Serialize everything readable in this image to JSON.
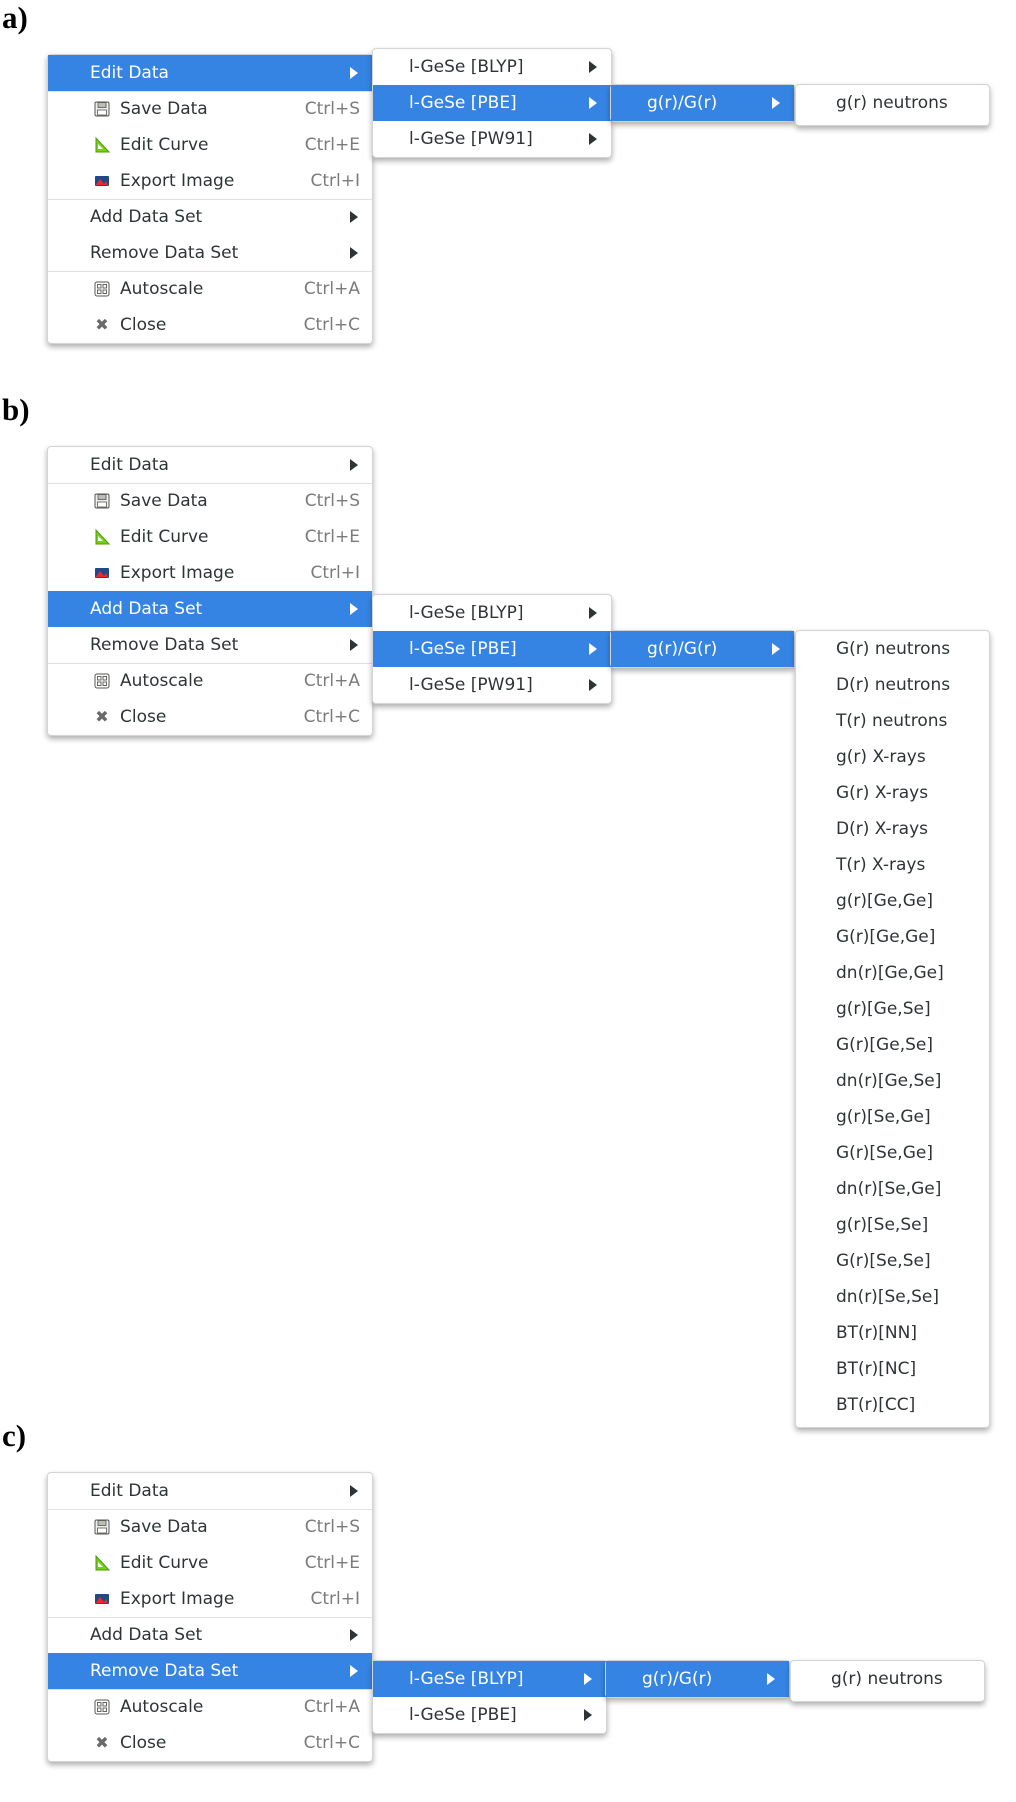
{
  "panels": [
    {
      "label": "a)",
      "main_menu": [
        {
          "label": "Edit Data",
          "shortcut": "",
          "icon": "",
          "submenu": true
        },
        {
          "label": "Save Data",
          "shortcut": "Ctrl+S",
          "icon": "save-icon",
          "submenu": false
        },
        {
          "label": "Edit Curve",
          "shortcut": "Ctrl+E",
          "icon": "edit-curve-icon",
          "submenu": false
        },
        {
          "label": "Export Image",
          "shortcut": "Ctrl+I",
          "icon": "export-image-icon",
          "submenu": false
        },
        {
          "label": "Add Data Set",
          "shortcut": "",
          "icon": "",
          "submenu": true
        },
        {
          "label": "Remove Data Set",
          "shortcut": "",
          "icon": "",
          "submenu": true
        },
        {
          "label": "Autoscale",
          "shortcut": "Ctrl+A",
          "icon": "autoscale-icon",
          "submenu": false
        },
        {
          "label": "Close",
          "shortcut": "Ctrl+C",
          "icon": "close-icon",
          "submenu": false
        }
      ],
      "highlighted": "Edit Data",
      "datasets": [
        "l-GeSe [BLYP]",
        "l-GeSe [PBE]",
        "l-GeSe [PW91]"
      ],
      "dataset_highlighted": "l-GeSe [PBE]",
      "function_menu": [
        "g(r)/G(r)"
      ],
      "leaf_items": [
        "g(r) neutrons"
      ]
    },
    {
      "label": "b)",
      "main_menu": [
        {
          "label": "Edit Data",
          "shortcut": "",
          "icon": "",
          "submenu": true
        },
        {
          "label": "Save Data",
          "shortcut": "Ctrl+S",
          "icon": "save-icon",
          "submenu": false
        },
        {
          "label": "Edit Curve",
          "shortcut": "Ctrl+E",
          "icon": "edit-curve-icon",
          "submenu": false
        },
        {
          "label": "Export Image",
          "shortcut": "Ctrl+I",
          "icon": "export-image-icon",
          "submenu": false
        },
        {
          "label": "Add Data Set",
          "shortcut": "",
          "icon": "",
          "submenu": true
        },
        {
          "label": "Remove Data Set",
          "shortcut": "",
          "icon": "",
          "submenu": true
        },
        {
          "label": "Autoscale",
          "shortcut": "Ctrl+A",
          "icon": "autoscale-icon",
          "submenu": false
        },
        {
          "label": "Close",
          "shortcut": "Ctrl+C",
          "icon": "close-icon",
          "submenu": false
        }
      ],
      "highlighted": "Add Data Set",
      "datasets": [
        "l-GeSe [BLYP]",
        "l-GeSe [PBE]",
        "l-GeSe [PW91]"
      ],
      "dataset_highlighted": "l-GeSe [PBE]",
      "function_menu": [
        "g(r)/G(r)"
      ],
      "leaf_items": [
        "G(r) neutrons",
        "D(r) neutrons",
        "T(r) neutrons",
        "g(r) X-rays",
        "G(r) X-rays",
        "D(r) X-rays",
        "T(r) X-rays",
        "g(r)[Ge,Ge]",
        "G(r)[Ge,Ge]",
        "dn(r)[Ge,Ge]",
        "g(r)[Ge,Se]",
        "G(r)[Ge,Se]",
        "dn(r)[Ge,Se]",
        "g(r)[Se,Ge]",
        "G(r)[Se,Ge]",
        "dn(r)[Se,Ge]",
        "g(r)[Se,Se]",
        "G(r)[Se,Se]",
        "dn(r)[Se,Se]",
        "BT(r)[NN]",
        "BT(r)[NC]",
        "BT(r)[CC]"
      ]
    },
    {
      "label": "c)",
      "main_menu": [
        {
          "label": "Edit Data",
          "shortcut": "",
          "icon": "",
          "submenu": true
        },
        {
          "label": "Save Data",
          "shortcut": "Ctrl+S",
          "icon": "save-icon",
          "submenu": false
        },
        {
          "label": "Edit Curve",
          "shortcut": "Ctrl+E",
          "icon": "edit-curve-icon",
          "submenu": false
        },
        {
          "label": "Export Image",
          "shortcut": "Ctrl+I",
          "icon": "export-image-icon",
          "submenu": false
        },
        {
          "label": "Add Data Set",
          "shortcut": "",
          "icon": "",
          "submenu": true
        },
        {
          "label": "Remove Data Set",
          "shortcut": "",
          "icon": "",
          "submenu": true
        },
        {
          "label": "Autoscale",
          "shortcut": "Ctrl+A",
          "icon": "autoscale-icon",
          "submenu": false
        },
        {
          "label": "Close",
          "shortcut": "Ctrl+C",
          "icon": "close-icon",
          "submenu": false
        }
      ],
      "highlighted": "Remove Data Set",
      "datasets": [
        "l-GeSe [BLYP]",
        "l-GeSe [PBE]"
      ],
      "dataset_highlighted": "l-GeSe [BLYP]",
      "function_menu": [
        "g(r)/G(r)"
      ],
      "leaf_items": [
        "g(r) neutrons"
      ]
    }
  ],
  "colors": {
    "highlight": "#3584e4",
    "text": "#2e3436",
    "shortcut": "#7b7b7b",
    "separator": "#e0e0e0"
  }
}
